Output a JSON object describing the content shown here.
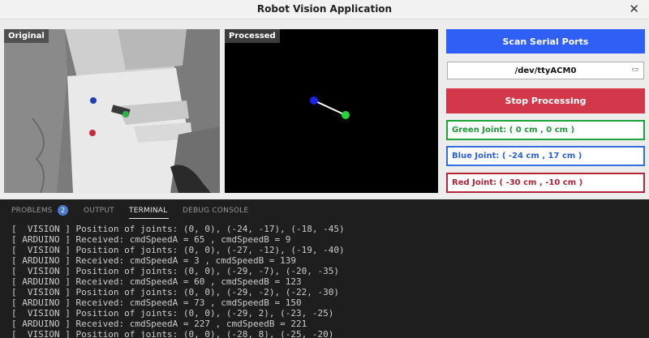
{
  "window": {
    "title": "Robot Vision Application"
  },
  "panels": {
    "original_label": "Original",
    "processed_label": "Processed"
  },
  "controls": {
    "scan_label": "Scan Serial Ports",
    "port_value": "/dev/ttyACM0",
    "stop_label": "Stop Processing",
    "green_joint": "Green Joint: ( 0 cm , 0 cm )",
    "blue_joint": "Blue Joint: ( -24 cm , 17 cm )",
    "red_joint": "Red Joint: ( -30 cm , -10 cm )"
  },
  "colors": {
    "scan": "#2f5ff5",
    "stop": "#d3374a",
    "green": "#1ea33a",
    "blue": "#2f6fe0",
    "red": "#b8243c"
  },
  "tabs": [
    {
      "label": "PROBLEMS",
      "badge": "2"
    },
    {
      "label": "OUTPUT"
    },
    {
      "label": "TERMINAL",
      "active": true
    },
    {
      "label": "DEBUG CONSOLE"
    }
  ],
  "terminal_lines": [
    "[  VISION ] Position of joints: (0, 0), (-24, -17), (-18, -45)",
    "[ ARDUINO ] Received: cmdSpeedA = 65 , cmdSpeedB = 9",
    "[  VISION ] Position of joints: (0, 0), (-27, -12), (-19, -40)",
    "[ ARDUINO ] Received: cmdSpeedA = 3 , cmdSpeedB = 139",
    "[  VISION ] Position of joints: (0, 0), (-29, -7), (-20, -35)",
    "[ ARDUINO ] Received: cmdSpeedA = 60 , cmdSpeedB = 123",
    "[  VISION ] Position of joints: (0, 0), (-29, -2), (-22, -30)",
    "[ ARDUINO ] Received: cmdSpeedA = 73 , cmdSpeedB = 150",
    "[  VISION ] Position of joints: (0, 0), (-29, 2), (-23, -25)",
    "[ ARDUINO ] Received: cmdSpeedA = 227 , cmdSpeedB = 221",
    "[  VISION ] Position of joints: (0, 0), (-28, 8), (-25, -20)"
  ]
}
